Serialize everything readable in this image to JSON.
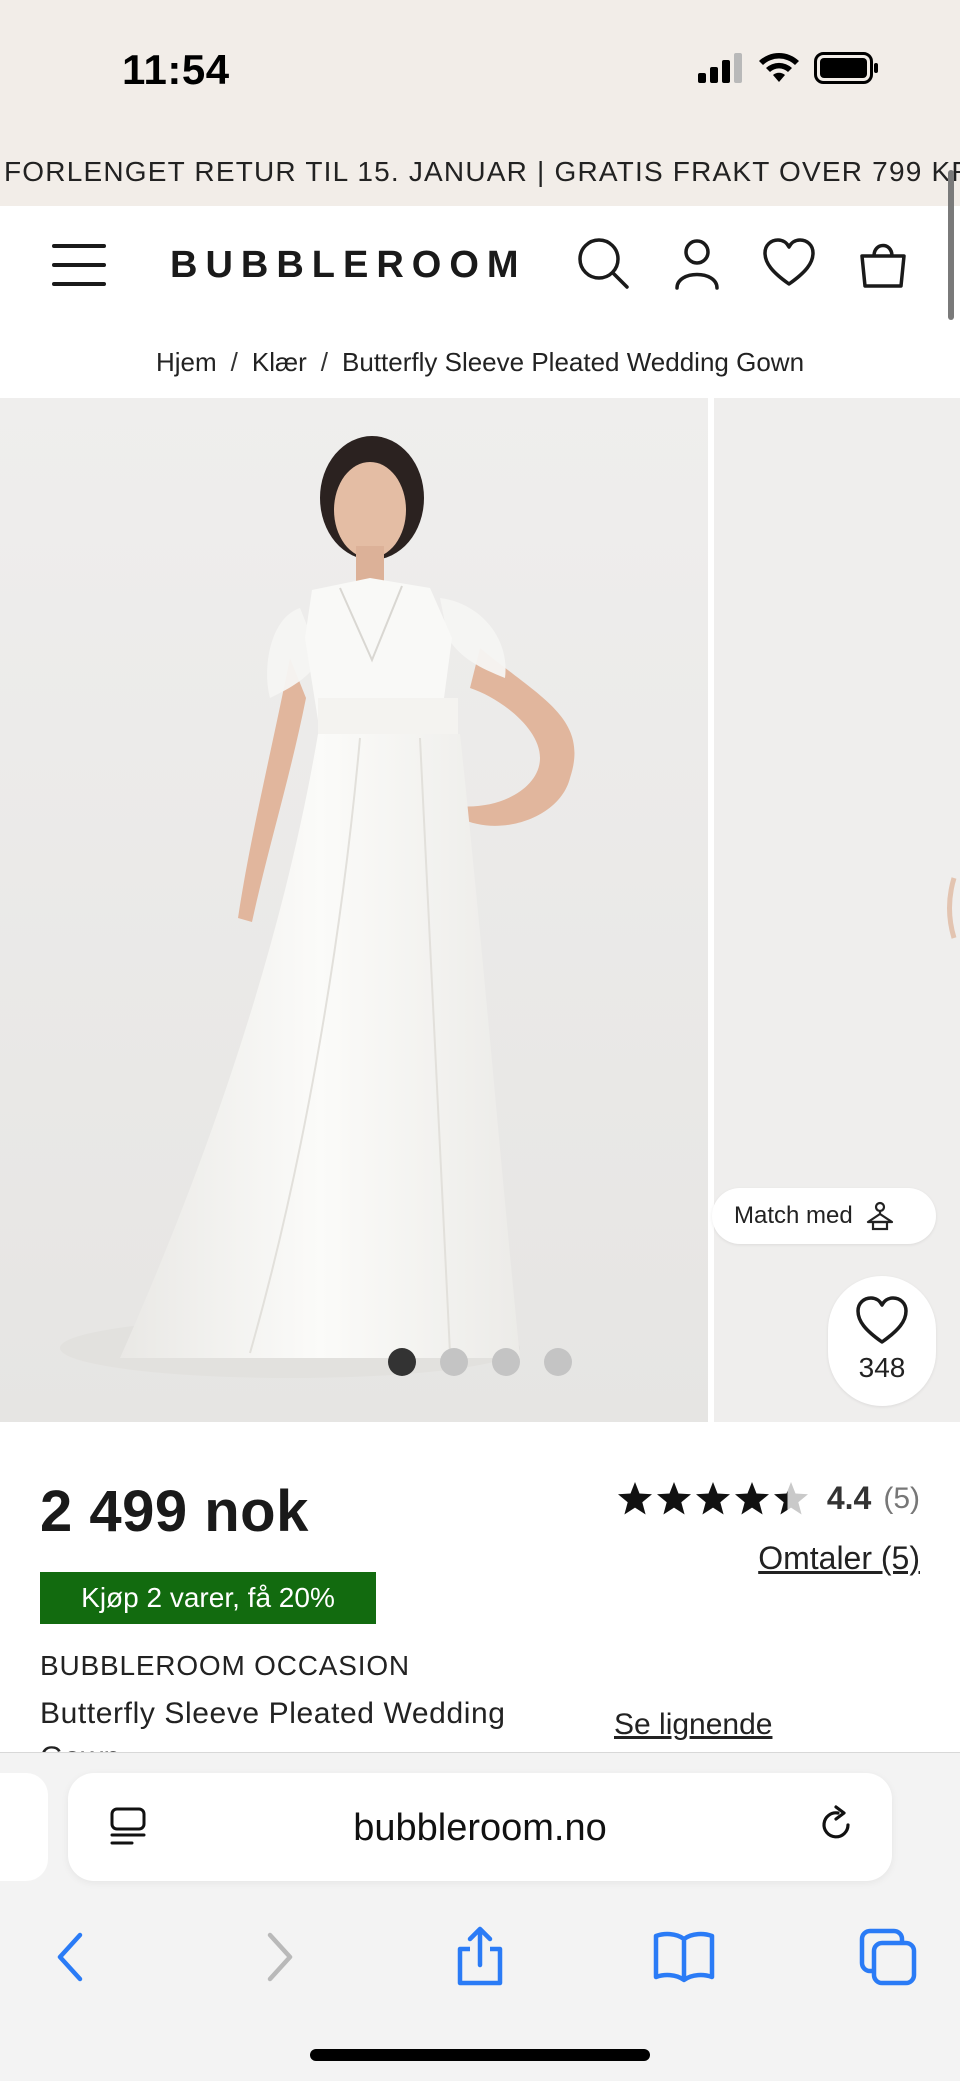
{
  "status_bar": {
    "time": "11:54"
  },
  "promo_banner": {
    "text": "FORLENGET RETUR TIL 15. JANUAR | GRATIS FRAKT OVER 799 KR*"
  },
  "header": {
    "logo": "BUBBLEROOM",
    "icons": [
      "menu-icon",
      "search-icon",
      "account-icon",
      "wishlist-heart-icon",
      "shopping-bag-icon"
    ]
  },
  "breadcrumb": {
    "items": [
      "Hjem",
      "Klær",
      "Butterfly Sleeve Pleated Wedding Gown"
    ],
    "separator": "/"
  },
  "gallery": {
    "slide_count": 4,
    "active_slide": 1,
    "match_label": "Match med",
    "favorite_count": "348"
  },
  "product": {
    "price": "2 499 nok",
    "promo_badge": "Kjøp 2 varer, få 20%",
    "brand": "BUBBLEROOM OCCASION",
    "name": "Butterfly Sleeve Pleated Wedding Gown",
    "rating_value": "4.4",
    "rating_stars": 4.4,
    "rating_count": "(5)",
    "reviews_link": "Omtaler (5)",
    "similar_link": "Se lignende",
    "promo_color": "#126b0f"
  },
  "browser": {
    "url": "bubbleroom.no",
    "accent_color": "#2a7bf6"
  }
}
